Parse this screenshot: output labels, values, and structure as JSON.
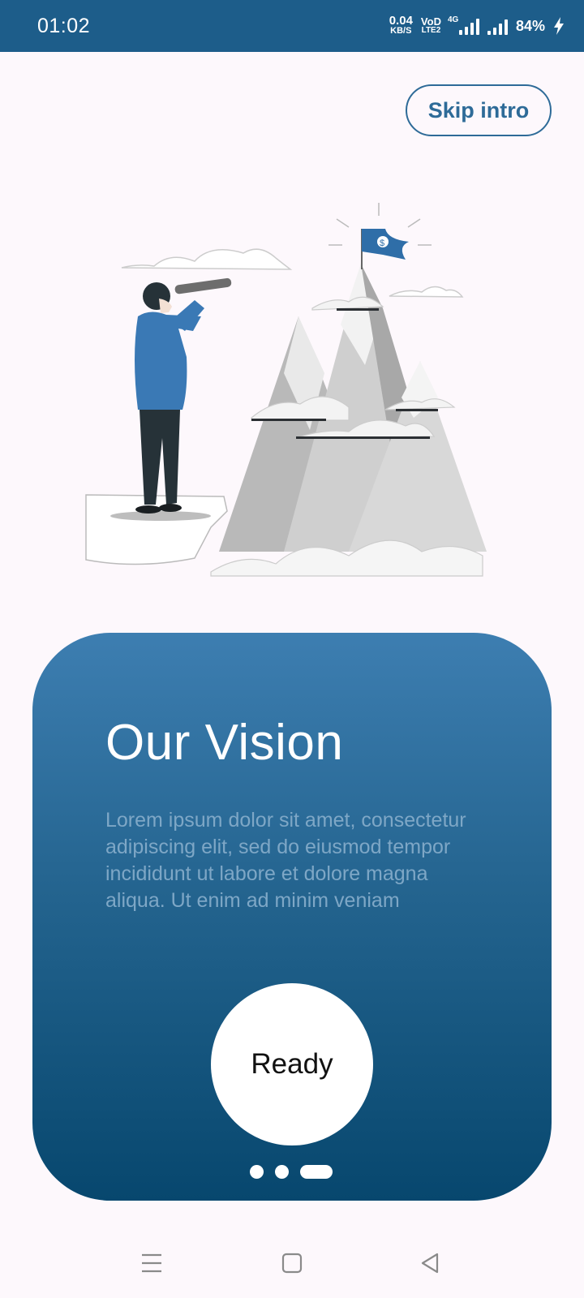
{
  "status_bar": {
    "time": "01:02",
    "net_speed_value": "0.04",
    "net_speed_unit": "KB/S",
    "vod_top": "VoD",
    "vod_bottom": "LTE2",
    "network_type": "4G",
    "battery": "84%"
  },
  "skip": {
    "label": "Skip intro"
  },
  "illustration": {
    "icon": "explorer-looking-at-mountain-illustration"
  },
  "card": {
    "title": "Our Vision",
    "body": "Lorem ipsum dolor sit amet, consectetur adipiscing elit, sed do eiusmod tempor incididunt ut labore et dolore magna aliqua. Ut enim ad minim veniam",
    "button_label": "Ready",
    "pager": {
      "count": 3,
      "active_index": 2
    }
  },
  "colors": {
    "status_bar": "#1d5d8a",
    "accent": "#2e6b98",
    "card_top": "#3d7eb1",
    "card_bottom": "#07476e"
  },
  "nav": {
    "icons": [
      "menu-icon",
      "home-icon",
      "back-icon"
    ]
  }
}
